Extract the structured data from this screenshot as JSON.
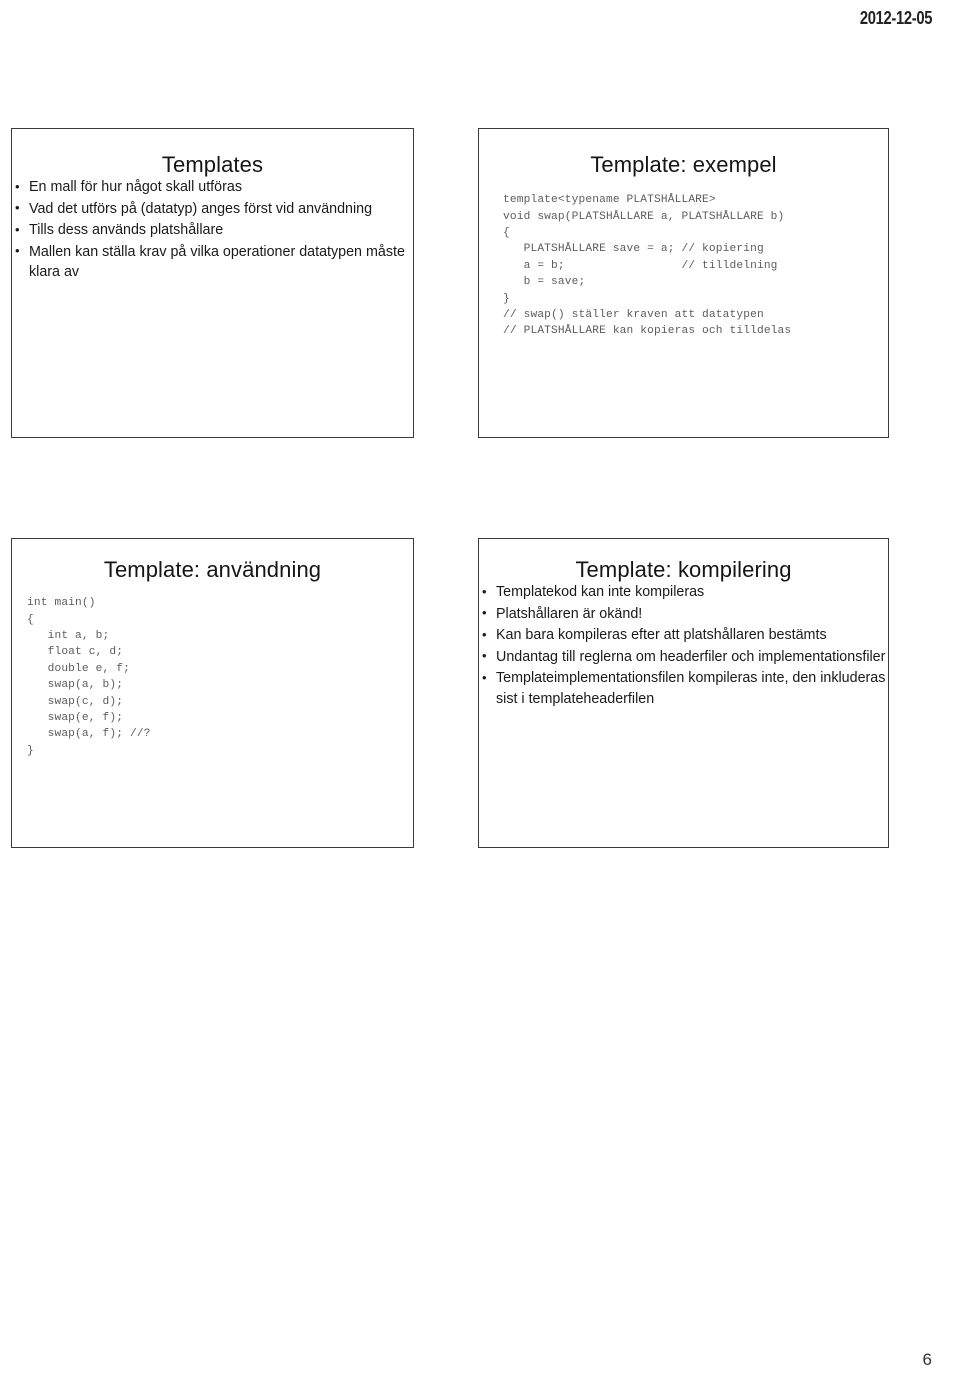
{
  "header": {
    "date": "2012-12-05"
  },
  "footer": {
    "page_number": "6"
  },
  "slides": [
    {
      "id": "templates",
      "title": "Templates",
      "kind": "bullets",
      "bullets": [
        "En mall för hur något skall utföras",
        "Vad det utförs på (datatyp) anges först vid användning",
        "Tills dess används platshållare",
        "Mallen kan ställa krav på vilka operationer datatypen måste klara av"
      ]
    },
    {
      "id": "template-exempel",
      "title": "Template: exempel",
      "kind": "code",
      "code": "template<typename PLATSHÅLLARE>\nvoid swap(PLATSHÅLLARE a, PLATSHÅLLARE b)\n{\n   PLATSHÅLLARE save = a; // kopiering\n   a = b;                 // tilldelning\n   b = save;\n}\n// swap() ställer kraven att datatypen\n// PLATSHÅLLARE kan kopieras och tilldelas"
    },
    {
      "id": "template-anvandning",
      "title": "Template: användning",
      "kind": "code",
      "code": "int main()\n{\n   int a, b;\n   float c, d;\n   double e, f;\n   swap(a, b);\n   swap(c, d);\n   swap(e, f);\n   swap(a, f); //?\n}"
    },
    {
      "id": "template-kompilering",
      "title": "Template: kompilering",
      "kind": "bullets",
      "bullets": [
        "Templatekod kan inte kompileras",
        "Platshållaren är okänd!",
        "Kan bara kompileras efter att platshållaren bestämts",
        "Undantag till reglerna om headerfiler och implementationsfiler",
        "Templateimplementationsfilen kompileras inte, den inkluderas sist i templateheaderfilen"
      ]
    }
  ]
}
